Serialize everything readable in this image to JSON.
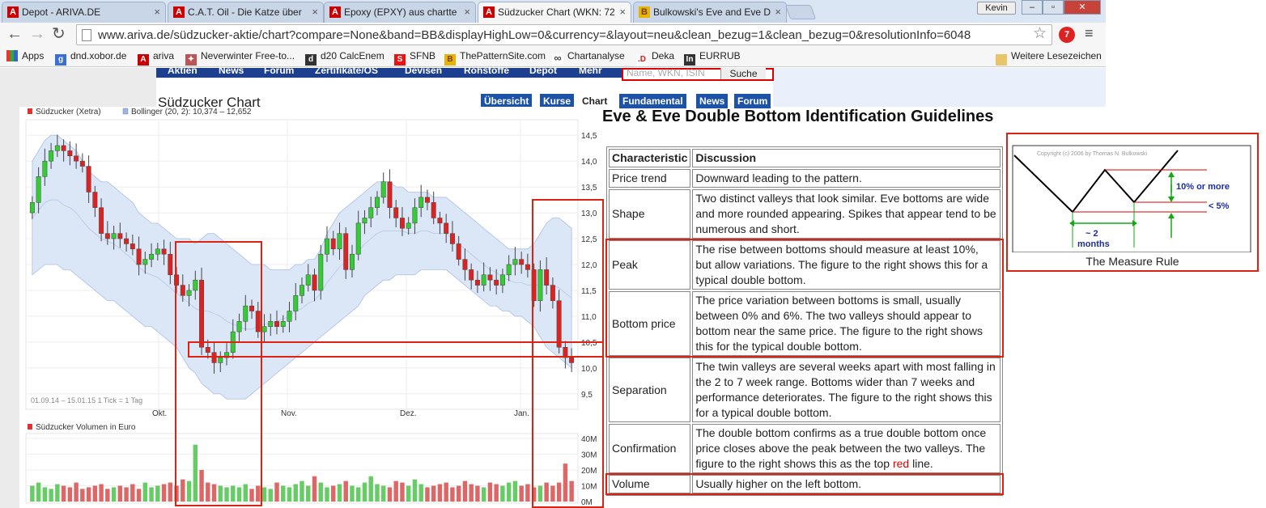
{
  "browser": {
    "tabs": [
      {
        "title": "Depot - ARIVA.DE",
        "icon": "ariva-icon",
        "active": false
      },
      {
        "title": "C.A.T. Oil - Die Katze über",
        "icon": "ariva-icon",
        "active": false
      },
      {
        "title": "Epoxy (EPXY) aus chartte",
        "icon": "ariva-icon",
        "active": false
      },
      {
        "title": "Südzucker Chart (WKN: 72",
        "icon": "ariva-icon",
        "active": true
      },
      {
        "title": "Bulkowski's Eve and Eve D",
        "icon": "bulkowski-icon",
        "active": false
      }
    ],
    "user": "Kevin",
    "url": "www.ariva.de/südzucker-aktie/chart?compare=None&band=BB&displayHighLow=0&currency=&layout=neu&clean_bezug=1&clean_bezug=0&resolutionInfo=6048",
    "bookmarks": [
      "Apps",
      "dnd.xobor.de",
      "ariva",
      "Neverwinter Free-to...",
      "d20 CalcEnem",
      "SFNB",
      "ThePatternSite.com",
      "Chartanalyse",
      "Deka",
      "EURRUB"
    ],
    "other_bookmarks": "Weitere Lesezeichen",
    "badge": "7"
  },
  "site": {
    "nav": [
      "Aktien",
      "News",
      "Forum",
      "Zertifikate/OS",
      "Devisen",
      "Rohstoffe",
      "Depot",
      "Mehr"
    ],
    "search_placeholder": "Name, WKN, ISIN",
    "search_button": "Suche",
    "page_title": "Südzucker Chart",
    "page_tabs": [
      "Übersicht",
      "Kurse",
      "Chart",
      "Fundamental",
      "News",
      "Forum"
    ],
    "active_tab": "Chart"
  },
  "chart_data": {
    "type": "candlestick",
    "legend": [
      {
        "name": "Südzucker (Xetra)",
        "color": "#d33"
      },
      {
        "name": "Bollinger (20, 2): 10,374 – 12,652",
        "color": "#9fb6dc"
      }
    ],
    "price_ticks": [
      "14,5",
      "14,0",
      "13,5",
      "13,0",
      "12,5",
      "12,0",
      "11,5",
      "11,0",
      "10,5",
      "10,0",
      "9,5"
    ],
    "ylim": [
      9.2,
      14.8
    ],
    "x_ticks": [
      "Okt.",
      "Nov.",
      "Dez.",
      "Jan."
    ],
    "range_note": "01.09.14 – 15.01.15   1 Tick = 1 Tag",
    "closes": [
      13.2,
      13.7,
      14.0,
      14.2,
      14.3,
      14.2,
      14.1,
      14.0,
      13.9,
      13.4,
      13.1,
      12.6,
      12.5,
      12.6,
      12.5,
      12.4,
      12.3,
      12.0,
      12.1,
      12.2,
      12.3,
      12.2,
      11.8,
      11.6,
      11.4,
      11.5,
      11.7,
      10.4,
      10.3,
      10.1,
      10.2,
      10.3,
      10.7,
      10.9,
      11.2,
      11.1,
      10.7,
      10.8,
      10.9,
      10.8,
      10.9,
      11.1,
      11.4,
      11.6,
      11.8,
      11.5,
      12.2,
      12.5,
      12.3,
      12.6,
      11.9,
      12.2,
      12.8,
      12.9,
      13.1,
      13.3,
      13.6,
      13.1,
      12.9,
      12.7,
      12.8,
      13.1,
      13.3,
      13.2,
      12.9,
      12.8,
      12.6,
      12.4,
      12.1,
      11.9,
      11.7,
      11.6,
      11.8,
      11.7,
      11.6,
      11.8,
      12.0,
      12.1,
      12.0,
      11.9,
      11.3,
      11.9,
      11.6,
      11.3,
      10.4,
      10.2,
      10.1
    ],
    "bb_upper": [
      14.0,
      14.2,
      14.4,
      14.5,
      14.5,
      14.4,
      14.3,
      14.2,
      14.0,
      13.8,
      13.7,
      13.6,
      13.6,
      13.5,
      13.4,
      13.3,
      13.2,
      13.0,
      12.9,
      12.8,
      12.8,
      12.7,
      12.6,
      12.5,
      12.5,
      12.5,
      12.4,
      12.5,
      12.6,
      12.6,
      12.5,
      12.4,
      12.3,
      12.2,
      12.1,
      12.0,
      12.0,
      12.0,
      11.9,
      11.9,
      11.9,
      11.9,
      12.0,
      12.0,
      12.1,
      12.1,
      12.3,
      12.6,
      12.8,
      13.0,
      13.1,
      13.2,
      13.3,
      13.4,
      13.5,
      13.6,
      13.6,
      13.6,
      13.5,
      13.5,
      13.4,
      13.4,
      13.4,
      13.4,
      13.3,
      13.3,
      13.3,
      13.2,
      13.1,
      13.0,
      12.9,
      12.8,
      12.7,
      12.6,
      12.5,
      12.4,
      12.3,
      12.3,
      12.3,
      12.3,
      12.4,
      12.6,
      12.8,
      12.9,
      12.9,
      12.8,
      12.7
    ],
    "bb_lower": [
      11.8,
      11.9,
      12.0,
      12.0,
      12.0,
      11.9,
      11.9,
      11.8,
      11.7,
      11.6,
      11.5,
      11.4,
      11.3,
      11.3,
      11.2,
      11.1,
      11.0,
      10.9,
      10.8,
      10.8,
      10.7,
      10.6,
      10.5,
      10.4,
      10.2,
      10.0,
      9.9,
      9.7,
      9.6,
      9.5,
      9.5,
      9.4,
      9.4,
      9.4,
      9.4,
      9.5,
      9.6,
      9.7,
      9.8,
      9.9,
      10.0,
      10.1,
      10.2,
      10.3,
      10.4,
      10.5,
      10.6,
      10.7,
      10.8,
      10.9,
      11.0,
      11.1,
      11.2,
      11.4,
      11.5,
      11.6,
      11.7,
      11.7,
      11.8,
      11.8,
      11.8,
      11.8,
      11.9,
      11.9,
      11.9,
      11.9,
      11.9,
      11.8,
      11.7,
      11.6,
      11.5,
      11.4,
      11.3,
      11.2,
      11.2,
      11.1,
      11.1,
      11.0,
      11.0,
      10.9,
      10.8,
      10.6,
      10.4,
      10.3,
      10.2,
      10.1,
      10.0
    ],
    "volume_title": "Südzucker Volumen in Euro",
    "volume_ticks": [
      "40M",
      "30M",
      "20M",
      "10M",
      "0M"
    ],
    "volumes": [
      10,
      12,
      9,
      8,
      11,
      10,
      9,
      12,
      8,
      9,
      10,
      11,
      8,
      9,
      10,
      9,
      11,
      8,
      12,
      9,
      10,
      11,
      12,
      10,
      14,
      13,
      36,
      20,
      12,
      11,
      10,
      9,
      10,
      9,
      11,
      8,
      10,
      9,
      8,
      12,
      10,
      9,
      11,
      13,
      10,
      16,
      12,
      9,
      10,
      11,
      13,
      10,
      9,
      12,
      16,
      11,
      10,
      9,
      13,
      12,
      10,
      14,
      11,
      9,
      10,
      11,
      12,
      9,
      10,
      13,
      11,
      10,
      9,
      12,
      11,
      10,
      12,
      13,
      10,
      11,
      9,
      10,
      12,
      10,
      12,
      24,
      13
    ]
  },
  "article": {
    "title": "Eve & Eve Double Bottom Identification Guidelines",
    "col_char": "Characteristic",
    "col_disc": "Discussion",
    "rows": [
      {
        "c": "Price trend",
        "d": "Downward leading to the pattern."
      },
      {
        "c": "Shape",
        "d": "Two distinct valleys that look similar. Eve bottoms are wide and more rounded appearing. Spikes that appear tend to be numerous and short."
      },
      {
        "c": "Peak",
        "d": "The rise between bottoms should measure at least 10%, but allow variations. The figure to the right shows this for a typical double bottom."
      },
      {
        "c": "Bottom price",
        "d": "The price variation between bottoms is small, usually between 0% and 6%. The two valleys should appear to bottom near the same price. The figure to the right shows this for the typical double bottom."
      },
      {
        "c": "Separation",
        "d": "The twin valleys are several weeks apart with most falling in the 2 to 7 week range. Bottoms wider than 7 weeks and performance deteriorates. The figure to the right shows this for a typical double bottom."
      },
      {
        "c": "Confirmation",
        "d": "The double bottom confirms as a true double bottom once price closes above the peak between the two valleys. The figure to the right shows this as the top ",
        "d_red": "red",
        "d_end": " line."
      },
      {
        "c": "Volume",
        "d": "Usually higher on the left bottom."
      }
    ],
    "figure": {
      "copyright": "Copyright (c) 2006 by Thomas N. Bulkowski",
      "rise": "10% or more",
      "variation": "< 5%",
      "months_a": "~ 2",
      "months_b": "months",
      "caption": "The Measure Rule"
    }
  }
}
